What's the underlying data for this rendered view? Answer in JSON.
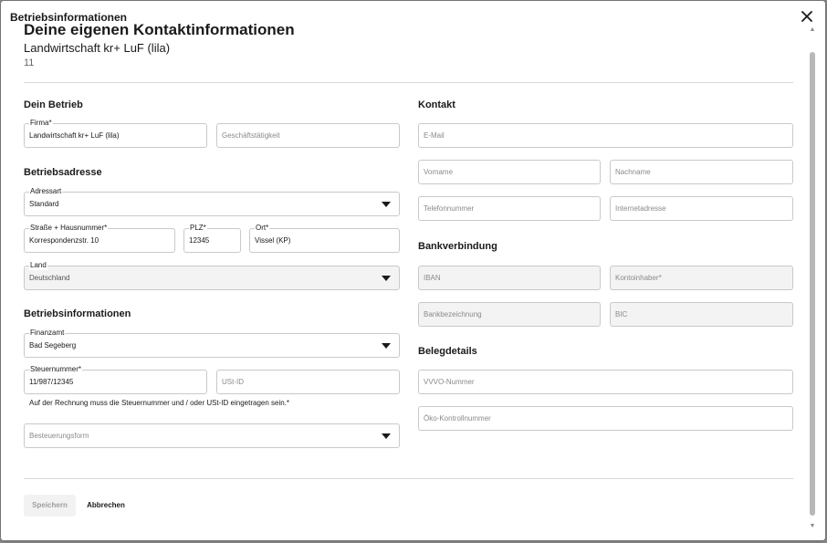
{
  "dialog": {
    "title": "Betriebsinformationen"
  },
  "header": {
    "title": "Deine eigenen Kontaktinformationen",
    "subtitle": "Landwirtschaft kr+ LuF (lila)",
    "number": "11"
  },
  "left": {
    "betrieb": {
      "heading": "Dein Betrieb",
      "firma_label": "Firma*",
      "firma_value": "Landwirtschaft kr+ LuF (lila)",
      "taetigkeit_placeholder": "Geschäftstätigkeit"
    },
    "adresse": {
      "heading": "Betriebsadresse",
      "adressart_label": "Adressart",
      "adressart_value": "Standard",
      "strasse_label": "Straße + Hausnummer*",
      "strasse_value": "Korrespondenzstr. 10",
      "plz_label": "PLZ*",
      "plz_value": "12345",
      "ort_label": "Ort*",
      "ort_value": "Vissel (KP)",
      "land_label": "Land",
      "land_value": "Deutschland"
    },
    "info": {
      "heading": "Betriebsinformationen",
      "finanzamt_label": "Finanzamt",
      "finanzamt_value": "Bad Segeberg",
      "steuernummer_label": "Steuernummer*",
      "steuernummer_value": "11/987/12345",
      "ustid_placeholder": "USt-ID",
      "hint": "Auf der Rechnung muss die Steuernummer und / oder USt-ID eingetragen sein.*",
      "besteuerung_placeholder": "Besteuerungsform"
    }
  },
  "right": {
    "kontakt": {
      "heading": "Kontakt",
      "email_placeholder": "E-Mail",
      "vorname_placeholder": "Vorname",
      "nachname_placeholder": "Nachname",
      "telefon_placeholder": "Telefonnummer",
      "internet_placeholder": "Internetadresse"
    },
    "bank": {
      "heading": "Bankverbindung",
      "iban_placeholder": "IBAN",
      "inhaber_placeholder": "Kontoinhaber*",
      "bankbez_placeholder": "Bankbezeichnung",
      "bic_placeholder": "BIC"
    },
    "beleg": {
      "heading": "Belegdetails",
      "vvvo_placeholder": "VVVO-Nummer",
      "oeko_placeholder": "Öko-Kontrollnummer"
    }
  },
  "footer": {
    "save_label": "Speichern",
    "cancel_label": "Abbrechen"
  },
  "icons": {
    "close": "close-icon",
    "caret": "chevron-down-icon"
  }
}
